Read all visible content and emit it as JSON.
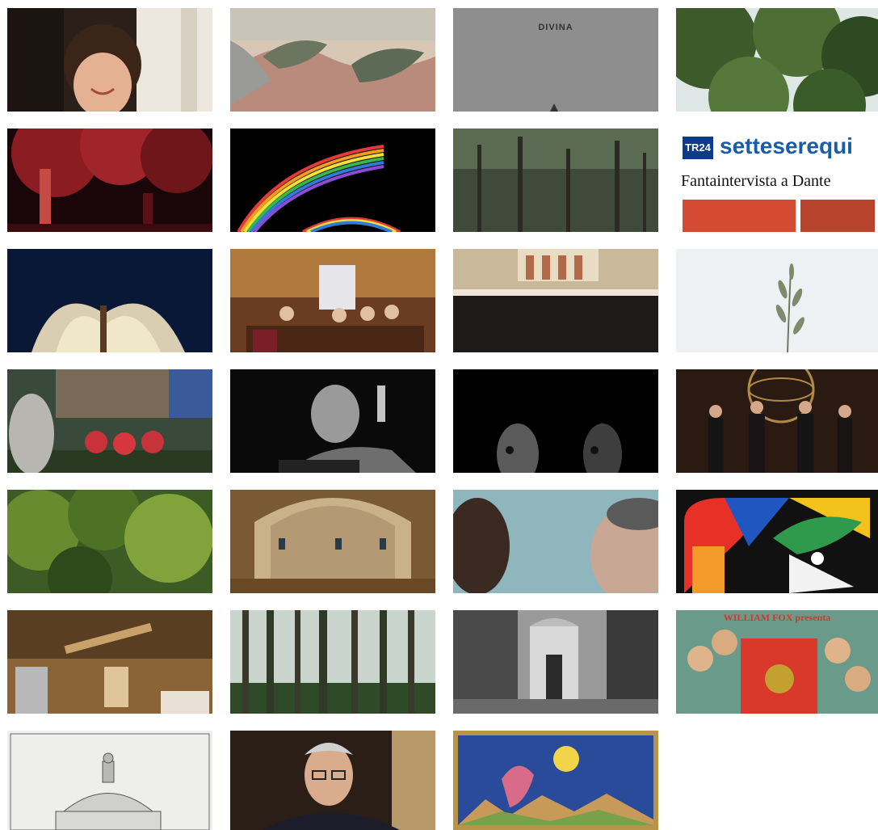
{
  "gallery": {
    "tiles": [
      {
        "name": "photo-woman-smiling"
      },
      {
        "name": "painting-laurel-profile"
      },
      {
        "name": "poster-divina",
        "text": "DIVINA"
      },
      {
        "name": "photo-tree-canopy"
      },
      {
        "name": "photo-red-lit-tree-performance"
      },
      {
        "name": "photo-rainbow-arcs"
      },
      {
        "name": "photo-pine-forest"
      },
      {
        "name": "newspaper-settesere",
        "masthead": "setteserequi",
        "logo": "TR24",
        "headline": "Fantaintervista a Dante"
      },
      {
        "name": "photo-stage-fabric-dancer"
      },
      {
        "name": "photo-panel-discussion"
      },
      {
        "name": "photo-choir-orchestra"
      },
      {
        "name": "photo-olive-sprig"
      },
      {
        "name": "photo-outdoor-audience"
      },
      {
        "name": "photo-actor-pointing"
      },
      {
        "name": "photo-dark-faces"
      },
      {
        "name": "photo-singers-armillary"
      },
      {
        "name": "photo-green-trees"
      },
      {
        "name": "photo-cloister-arches"
      },
      {
        "name": "photo-blurred-faces"
      },
      {
        "name": "poster-geometric-dante"
      },
      {
        "name": "photo-craft-tools"
      },
      {
        "name": "photo-tall-trunks"
      },
      {
        "name": "photo-bw-dante-tomb"
      },
      {
        "name": "poster-william-fox",
        "text": "WILLIAM FOX presenta"
      },
      {
        "name": "engraving-dome"
      },
      {
        "name": "photo-speaker-glasses"
      },
      {
        "name": "miniature-paradise"
      }
    ]
  }
}
